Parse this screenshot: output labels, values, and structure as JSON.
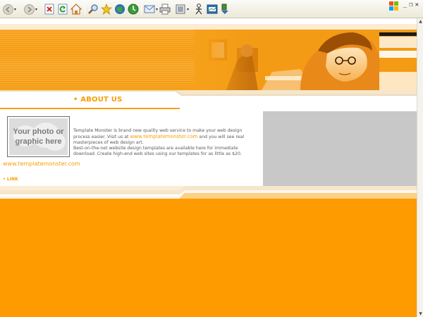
{
  "browser": {
    "toolbar_icons": [
      "back-icon",
      "forward-icon",
      "stop-icon",
      "refresh-icon",
      "home-icon",
      "search-icon",
      "favorites-icon",
      "media-icon",
      "history-icon",
      "mail-icon",
      "print-icon",
      "edit-icon",
      "messenger-icon",
      "research-icon",
      "tools-icon"
    ],
    "window_controls": {
      "minimize": "_",
      "restore": "❐",
      "close": "✕"
    }
  },
  "site": {
    "about": {
      "title": "• ABOUT US",
      "p1_a": "Template Monster is brand new quality web service to make your web design process easier. Visit us at ",
      "p1_link": "www.templatemonster.com",
      "p1_b": " and you will see real masterpieces of web design art.",
      "p2": "Best-on-the-net website design templates are available here for immediate download. Create high-end web sites using our templates for as little as $20."
    },
    "photo_placeholder": "Your photo or graphic here",
    "site_link": "www.templatemonster.com",
    "small_link": "• LINK"
  },
  "colors": {
    "accent": "#f99e00",
    "orange_fill": "#fd9b00",
    "panel_grey": "#c8c8c8"
  }
}
